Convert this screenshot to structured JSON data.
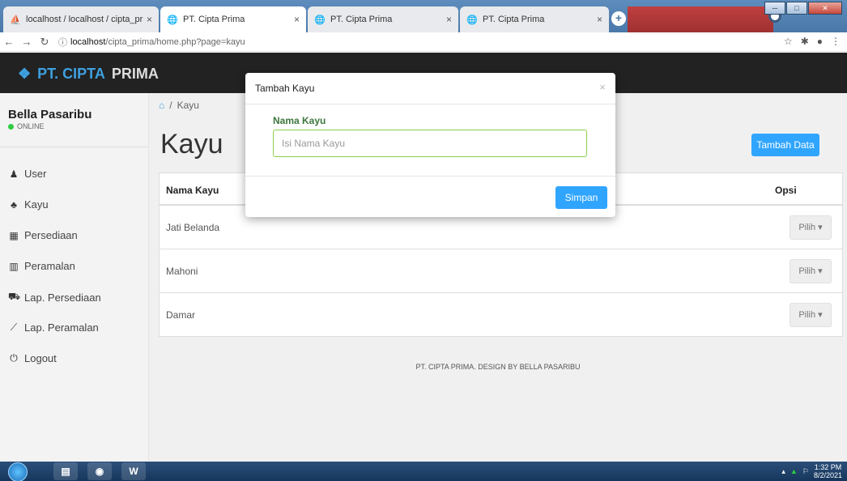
{
  "browser": {
    "tabs": [
      {
        "title": "localhost / localhost / cipta_prim",
        "icon": "phpmyadmin-icon"
      },
      {
        "title": "PT. Cipta Prima",
        "icon": "globe-icon"
      },
      {
        "title": "PT. Cipta Prima",
        "icon": "globe-icon"
      },
      {
        "title": "PT. Cipta Prima",
        "icon": "globe-icon"
      }
    ],
    "url_host": "localhost",
    "url_path": "/cipta_prima/home.php?page=kayu",
    "tab_close": "×",
    "new_tab": "+"
  },
  "header": {
    "brand_part1": "PT. CIPTA",
    "brand_part2": "PRIMA"
  },
  "sidebar": {
    "user_name": "Bella Pasaribu",
    "user_status": "ONLINE",
    "items": [
      {
        "label": "User",
        "icon": "user-icon"
      },
      {
        "label": "Kayu",
        "icon": "tree-icon"
      },
      {
        "label": "Persediaan",
        "icon": "calendar-icon"
      },
      {
        "label": "Peramalan",
        "icon": "bar-chart-icon"
      },
      {
        "label": "Lap. Persediaan",
        "icon": "cart-icon"
      },
      {
        "label": "Lap. Peramalan",
        "icon": "line-chart-icon"
      },
      {
        "label": "Logout",
        "icon": "power-icon"
      }
    ]
  },
  "main": {
    "breadcrumb": "Kayu",
    "page_title": "Kayu",
    "add_button": "Tambah Data",
    "table": {
      "headers": [
        "Nama Kayu",
        "Opsi"
      ],
      "rows": [
        {
          "name": "Jati Belanda",
          "action": "Pilih ▾"
        },
        {
          "name": "Mahoni",
          "action": "Pilih ▾"
        },
        {
          "name": "Damar",
          "action": "Pilih ▾"
        }
      ]
    },
    "footer": "PT. CIPTA PRIMA. DESIGN BY BELLA PASARIBU"
  },
  "modal": {
    "title": "Tambah Kayu",
    "close": "×",
    "field_label": "Nama Kayu",
    "field_placeholder": "Isi Nama Kayu",
    "field_value": "",
    "submit": "Simpan"
  },
  "taskbar": {
    "time": "1:32 PM",
    "date": "8/2/2021"
  },
  "colors": {
    "accent": "#30a5ff",
    "header_bg": "#222222",
    "valid_green": "#8bd04b"
  }
}
